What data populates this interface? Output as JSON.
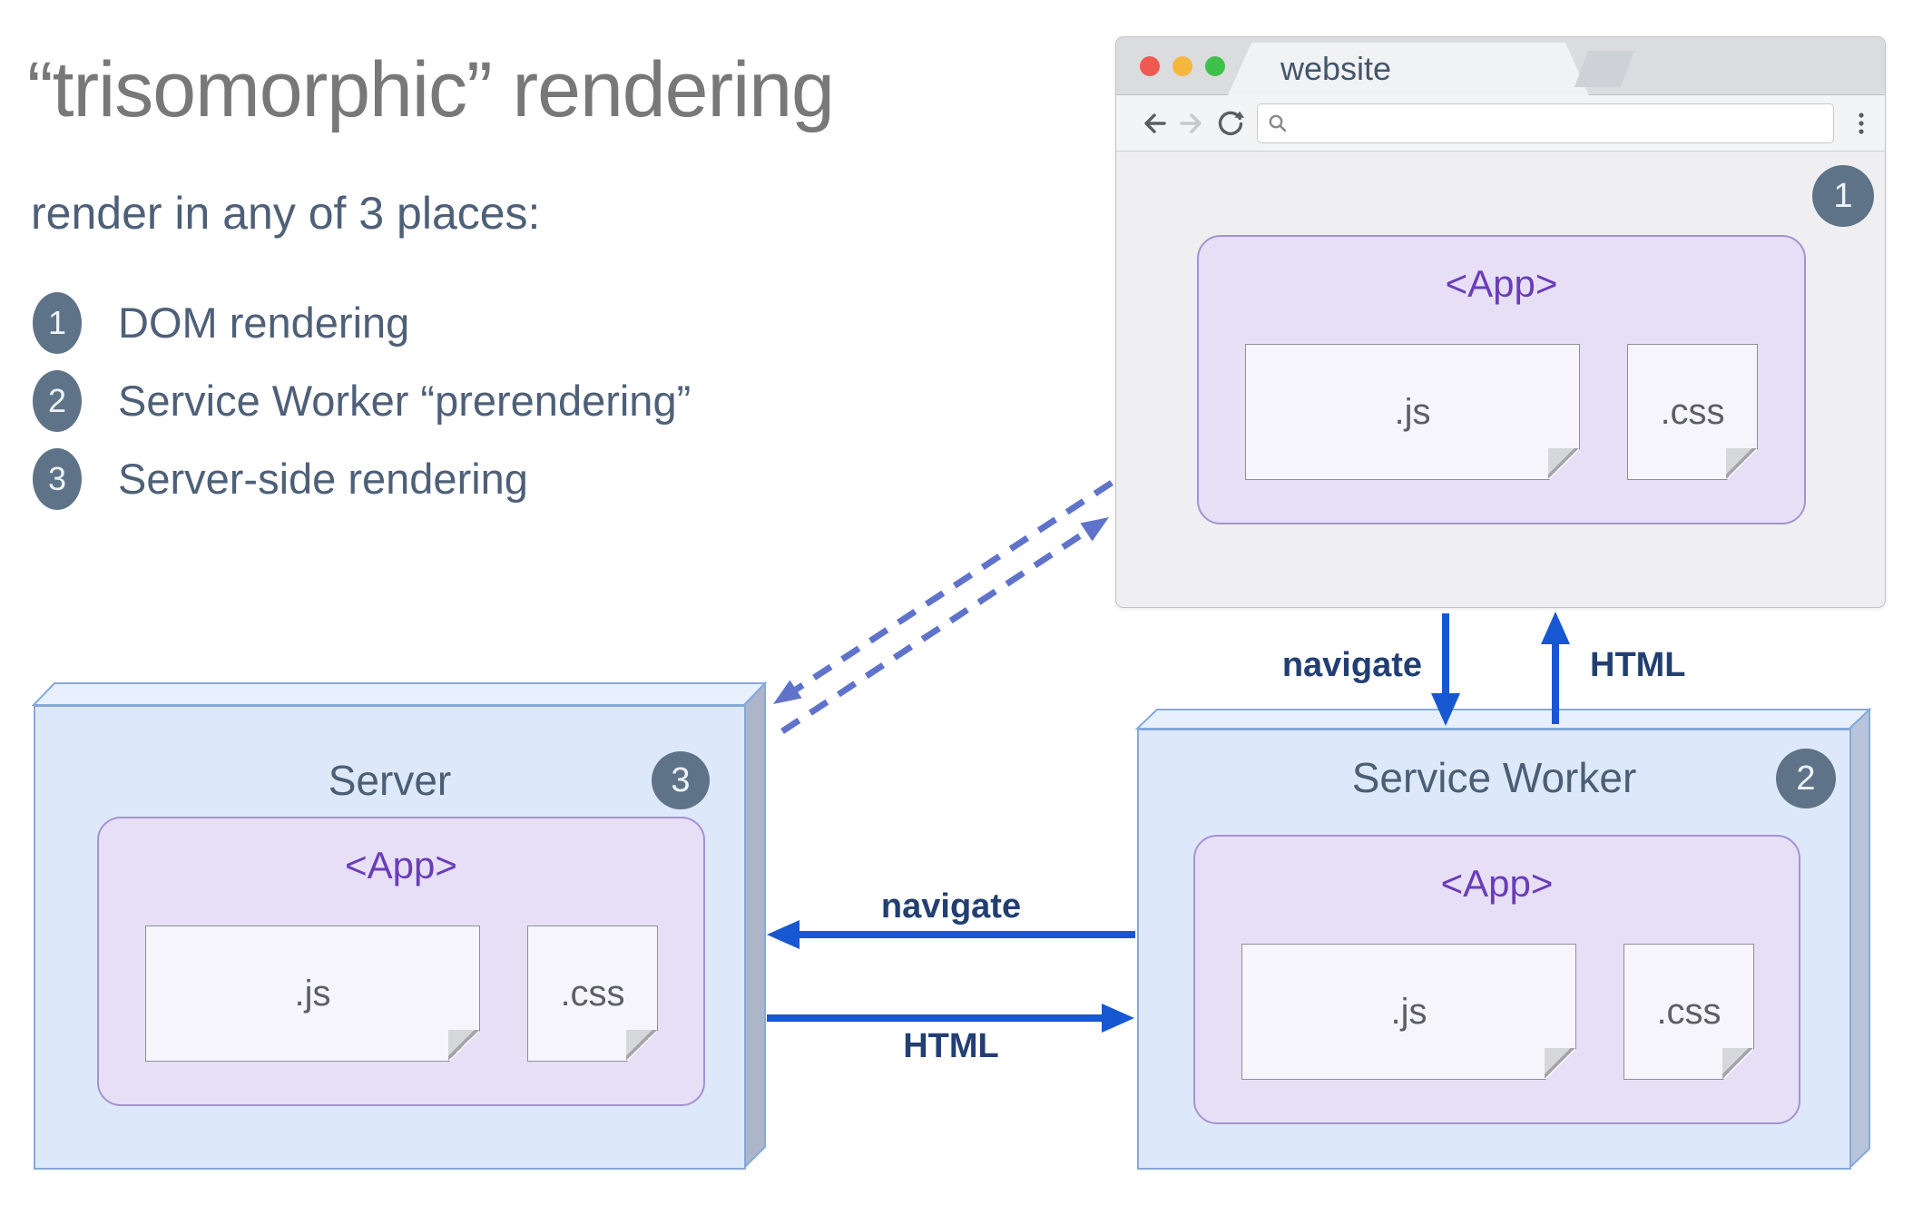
{
  "left_panel": {
    "title": "“trisomorphic” rendering",
    "subtitle": "render in any of 3 places:",
    "items": [
      {
        "num": "1",
        "label": "DOM rendering"
      },
      {
        "num": "2",
        "label": "Service Worker “prerendering”"
      },
      {
        "num": "3",
        "label": "Server-side rendering"
      }
    ]
  },
  "browser": {
    "tab_title": "website",
    "badge": "1",
    "url_value": "",
    "app": {
      "label": "<App>",
      "js": ".js",
      "css": ".css"
    }
  },
  "server": {
    "title": "Server",
    "badge": "3",
    "app": {
      "label": "<App>",
      "js": ".js",
      "css": ".css"
    }
  },
  "service_worker": {
    "title": "Service Worker",
    "badge": "2",
    "app": {
      "label": "<App>",
      "js": ".js",
      "css": ".css"
    }
  },
  "arrows": {
    "browser_to_sw": "navigate",
    "sw_to_browser": "HTML",
    "sw_to_server": "navigate",
    "server_to_sw": "HTML"
  },
  "colors": {
    "solid_arrow_blue": "#1757d1",
    "dashed_arrow_indigo": "#5f73ca",
    "badge_slate": "#5e7388",
    "app_purple": "#6a3db8",
    "box_fill": "#dde9fb",
    "box_border": "#85a9da",
    "purple_fill": "#e7dff6",
    "traffic_red": "#ee5a52",
    "traffic_yellow": "#f5b63e",
    "traffic_green": "#3ec14b"
  }
}
